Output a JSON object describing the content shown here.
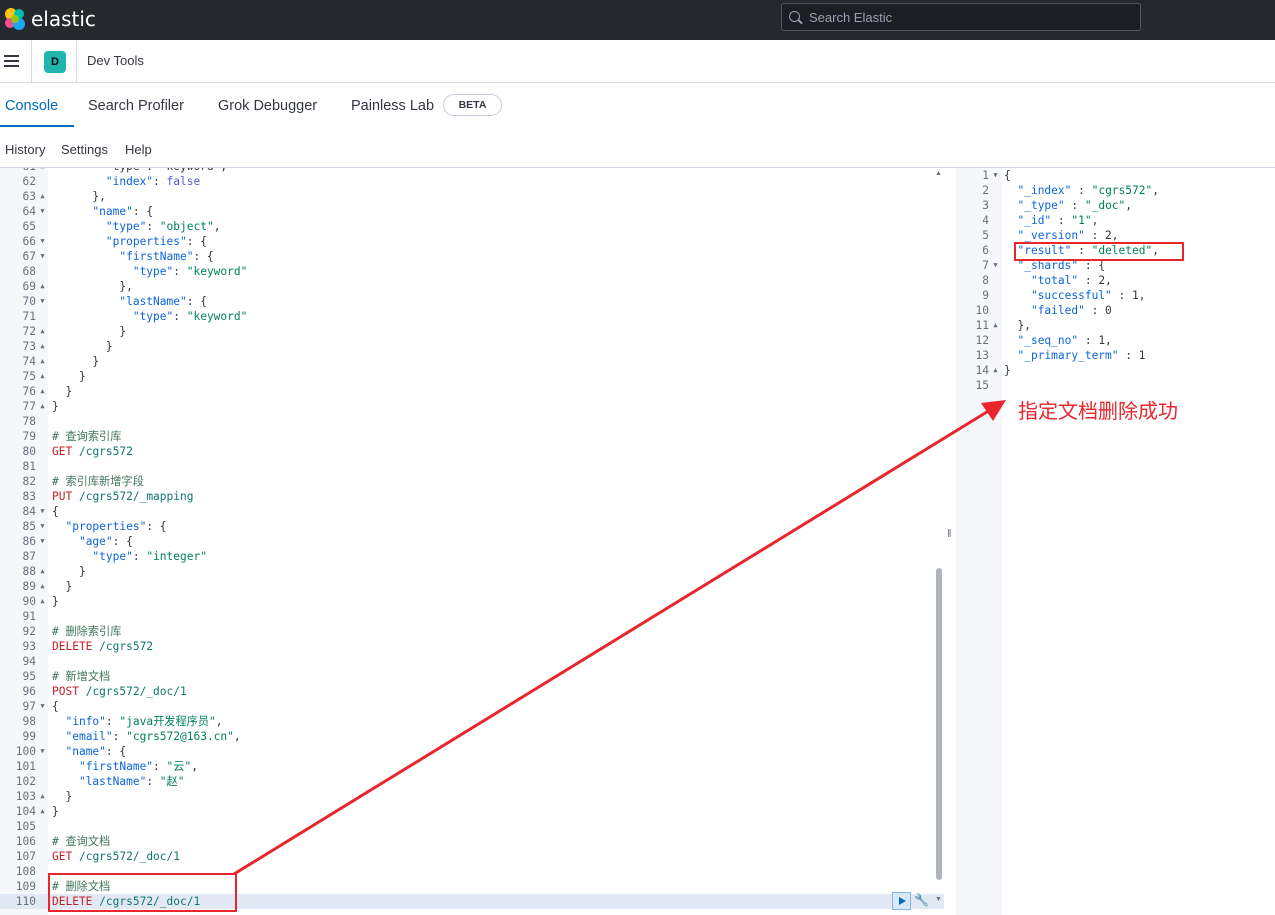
{
  "brand": "elastic",
  "search": {
    "placeholder": "Search Elastic"
  },
  "header": {
    "space_initial": "D",
    "app_title": "Dev Tools"
  },
  "tabs": [
    {
      "label": "Console",
      "active": true
    },
    {
      "label": "Search Profiler"
    },
    {
      "label": "Grok Debugger"
    },
    {
      "label": "Painless Lab",
      "badge": "BETA"
    }
  ],
  "subnav": [
    "History",
    "Settings",
    "Help"
  ],
  "editor": {
    "lines": [
      {
        "n": "61",
        "fold": "^",
        "html": "        \"type\": \"keyword\","
      },
      {
        "n": "62",
        "fold": "",
        "html": "        <span class=\"kw\">\"index\"</span>: <span class=\"bool\">false</span>"
      },
      {
        "n": "63",
        "fold": "^",
        "html": "      },"
      },
      {
        "n": "64",
        "fold": "v",
        "html": "      <span class=\"kw\">\"name\"</span>: {"
      },
      {
        "n": "65",
        "fold": "",
        "html": "        <span class=\"kw\">\"type\"</span>: <span class=\"str\">\"object\"</span>,"
      },
      {
        "n": "66",
        "fold": "v",
        "html": "        <span class=\"kw\">\"properties\"</span>: {"
      },
      {
        "n": "67",
        "fold": "v",
        "html": "          <span class=\"kw\">\"firstName\"</span>: {"
      },
      {
        "n": "68",
        "fold": "",
        "html": "            <span class=\"kw\">\"type\"</span>: <span class=\"str\">\"keyword\"</span>"
      },
      {
        "n": "69",
        "fold": "^",
        "html": "          },"
      },
      {
        "n": "70",
        "fold": "v",
        "html": "          <span class=\"kw\">\"lastName\"</span>: {"
      },
      {
        "n": "71",
        "fold": "",
        "html": "            <span class=\"kw\">\"type\"</span>: <span class=\"str\">\"keyword\"</span>"
      },
      {
        "n": "72",
        "fold": "^",
        "html": "          }"
      },
      {
        "n": "73",
        "fold": "^",
        "html": "        }"
      },
      {
        "n": "74",
        "fold": "^",
        "html": "      }"
      },
      {
        "n": "75",
        "fold": "^",
        "html": "    }"
      },
      {
        "n": "76",
        "fold": "^",
        "html": "  }"
      },
      {
        "n": "77",
        "fold": "^",
        "html": "}"
      },
      {
        "n": "78",
        "fold": "",
        "html": ""
      },
      {
        "n": "79",
        "fold": "",
        "html": "<span class=\"comment\"># 查询索引库</span>"
      },
      {
        "n": "80",
        "fold": "",
        "html": "<span class=\"method\">GET</span> <span class=\"path\">/cgrs572</span>"
      },
      {
        "n": "81",
        "fold": "",
        "html": ""
      },
      {
        "n": "82",
        "fold": "",
        "html": "<span class=\"comment\"># 索引库新增字段</span>"
      },
      {
        "n": "83",
        "fold": "",
        "html": "<span class=\"method\">PUT</span> <span class=\"path\">/cgrs572/_mapping</span>"
      },
      {
        "n": "84",
        "fold": "v",
        "html": "{"
      },
      {
        "n": "85",
        "fold": "v",
        "html": "  <span class=\"kw\">\"properties\"</span>: {"
      },
      {
        "n": "86",
        "fold": "v",
        "html": "    <span class=\"kw\">\"age\"</span>: {"
      },
      {
        "n": "87",
        "fold": "",
        "html": "      <span class=\"kw\">\"type\"</span>: <span class=\"str\">\"integer\"</span>"
      },
      {
        "n": "88",
        "fold": "^",
        "html": "    }"
      },
      {
        "n": "89",
        "fold": "^",
        "html": "  }"
      },
      {
        "n": "90",
        "fold": "^",
        "html": "}"
      },
      {
        "n": "91",
        "fold": "",
        "html": ""
      },
      {
        "n": "92",
        "fold": "",
        "html": "<span class=\"comment\"># 删除索引库</span>"
      },
      {
        "n": "93",
        "fold": "",
        "html": "<span class=\"method\">DELETE</span> <span class=\"path\">/cgrs572</span>"
      },
      {
        "n": "94",
        "fold": "",
        "html": ""
      },
      {
        "n": "95",
        "fold": "",
        "html": "<span class=\"comment\"># 新增文档</span>"
      },
      {
        "n": "96",
        "fold": "",
        "html": "<span class=\"method\">POST</span> <span class=\"path\">/cgrs572/_doc/1</span>"
      },
      {
        "n": "97",
        "fold": "v",
        "html": "{"
      },
      {
        "n": "98",
        "fold": "",
        "html": "  <span class=\"kw\">\"info\"</span>: <span class=\"str\">\"java开发程序员\"</span>,"
      },
      {
        "n": "99",
        "fold": "",
        "html": "  <span class=\"kw\">\"email\"</span>: <span class=\"str\">\"cgrs572@163.cn\"</span>,"
      },
      {
        "n": "100",
        "fold": "v",
        "html": "  <span class=\"kw\">\"name\"</span>: {"
      },
      {
        "n": "101",
        "fold": "",
        "html": "    <span class=\"kw\">\"firstName\"</span>: <span class=\"str\">\"云\"</span>,"
      },
      {
        "n": "102",
        "fold": "",
        "html": "    <span class=\"kw\">\"lastName\"</span>: <span class=\"str\">\"赵\"</span>"
      },
      {
        "n": "103",
        "fold": "^",
        "html": "  }"
      },
      {
        "n": "104",
        "fold": "^",
        "html": "}"
      },
      {
        "n": "105",
        "fold": "",
        "html": ""
      },
      {
        "n": "106",
        "fold": "",
        "html": "<span class=\"comment\"># 查询文档</span>"
      },
      {
        "n": "107",
        "fold": "",
        "html": "<span class=\"method\">GET</span> <span class=\"path\">/cgrs572/_doc/1</span>"
      },
      {
        "n": "108",
        "fold": "",
        "html": ""
      },
      {
        "n": "109",
        "fold": "",
        "html": "<span class=\"comment\"># 删除文档</span>"
      },
      {
        "n": "110",
        "fold": "",
        "html": "<span class=\"method\">DELETE</span> <span class=\"path\">/cgrs572/_doc/1</span>",
        "active": true
      }
    ]
  },
  "output": {
    "lines": [
      {
        "n": "1",
        "fold": "v",
        "html": "{"
      },
      {
        "n": "2",
        "fold": "",
        "html": "  <span class=\"kw\">\"_index\"</span> : <span class=\"str\">\"cgrs572\"</span>,"
      },
      {
        "n": "3",
        "fold": "",
        "html": "  <span class=\"kw\">\"_type\"</span> : <span class=\"str\">\"_doc\"</span>,"
      },
      {
        "n": "4",
        "fold": "",
        "html": "  <span class=\"kw\">\"_id\"</span> : <span class=\"str\">\"1\"</span>,"
      },
      {
        "n": "5",
        "fold": "",
        "html": "  <span class=\"kw\">\"_version\"</span> : 2,"
      },
      {
        "n": "6",
        "fold": "",
        "html": "  <span class=\"kw\">\"result\"</span> : <span class=\"str\">\"deleted\"</span>,"
      },
      {
        "n": "7",
        "fold": "v",
        "html": "  <span class=\"kw\">\"_shards\"</span> : {"
      },
      {
        "n": "8",
        "fold": "",
        "html": "    <span class=\"kw\">\"total\"</span> : 2,"
      },
      {
        "n": "9",
        "fold": "",
        "html": "    <span class=\"kw\">\"successful\"</span> : 1,"
      },
      {
        "n": "10",
        "fold": "",
        "html": "    <span class=\"kw\">\"failed\"</span> : 0"
      },
      {
        "n": "11",
        "fold": "^",
        "html": "  },"
      },
      {
        "n": "12",
        "fold": "",
        "html": "  <span class=\"kw\">\"_seq_no\"</span> : 1,"
      },
      {
        "n": "13",
        "fold": "",
        "html": "  <span class=\"kw\">\"_primary_term\"</span> : 1"
      },
      {
        "n": "14",
        "fold": "^",
        "html": "}"
      },
      {
        "n": "15",
        "fold": "",
        "html": ""
      }
    ]
  },
  "annotation": {
    "text": "指定文档删除成功",
    "color": "#e8262d"
  }
}
